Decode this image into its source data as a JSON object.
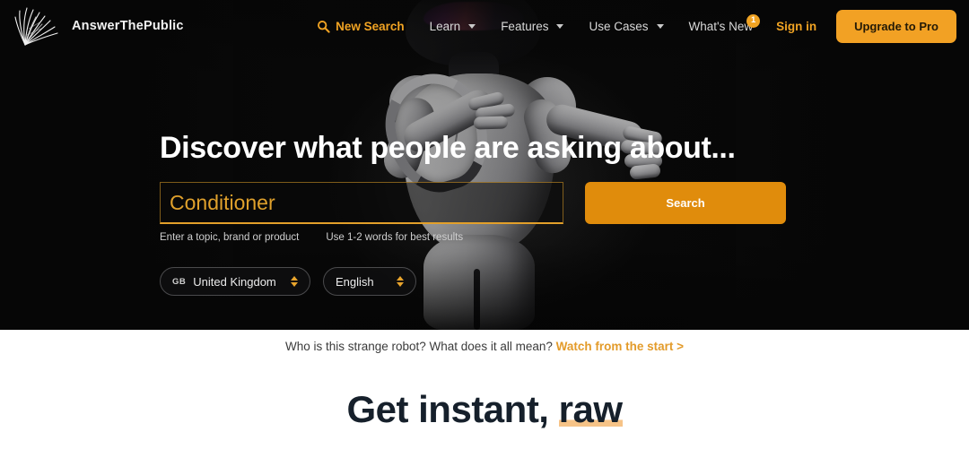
{
  "navbar": {
    "brand": {
      "name": "AnswerThePublic",
      "logo_icon": "seed-head-logo-icon"
    },
    "new_search": {
      "label": "New Search",
      "icon": "search-icon"
    },
    "menus": [
      {
        "label": "Learn",
        "icon": "chevron-down-icon"
      },
      {
        "label": "Features",
        "icon": "chevron-down-icon"
      },
      {
        "label": "Use Cases",
        "icon": "chevron-down-icon"
      }
    ],
    "whats_new": {
      "label": "What's New",
      "badge": "1"
    },
    "sign_in": "Sign in",
    "upgrade": "Upgrade to Pro"
  },
  "hero": {
    "title": "Discover what people are asking about...",
    "search": {
      "value": "Conditioner",
      "placeholder": "Enter a topic, brand or product",
      "button": "Search"
    },
    "hints": [
      "Enter a topic, brand or product",
      "Use 1-2 words for best results"
    ],
    "country": {
      "code": "GB",
      "label": "United Kingdom"
    },
    "language": {
      "label": "English"
    }
  },
  "light": {
    "robot_question": "Who is this strange robot? What does it all mean?",
    "watch_link": "Watch from the start >",
    "heading_part1": "Get instant, ",
    "heading_highlight": "raw"
  },
  "colors": {
    "accent_orange": "#f2a124",
    "search_button": "#e08c0c",
    "input_text": "#e0a12c",
    "hero_bg": "#0a0a0a",
    "highlight": "#f6c387"
  }
}
